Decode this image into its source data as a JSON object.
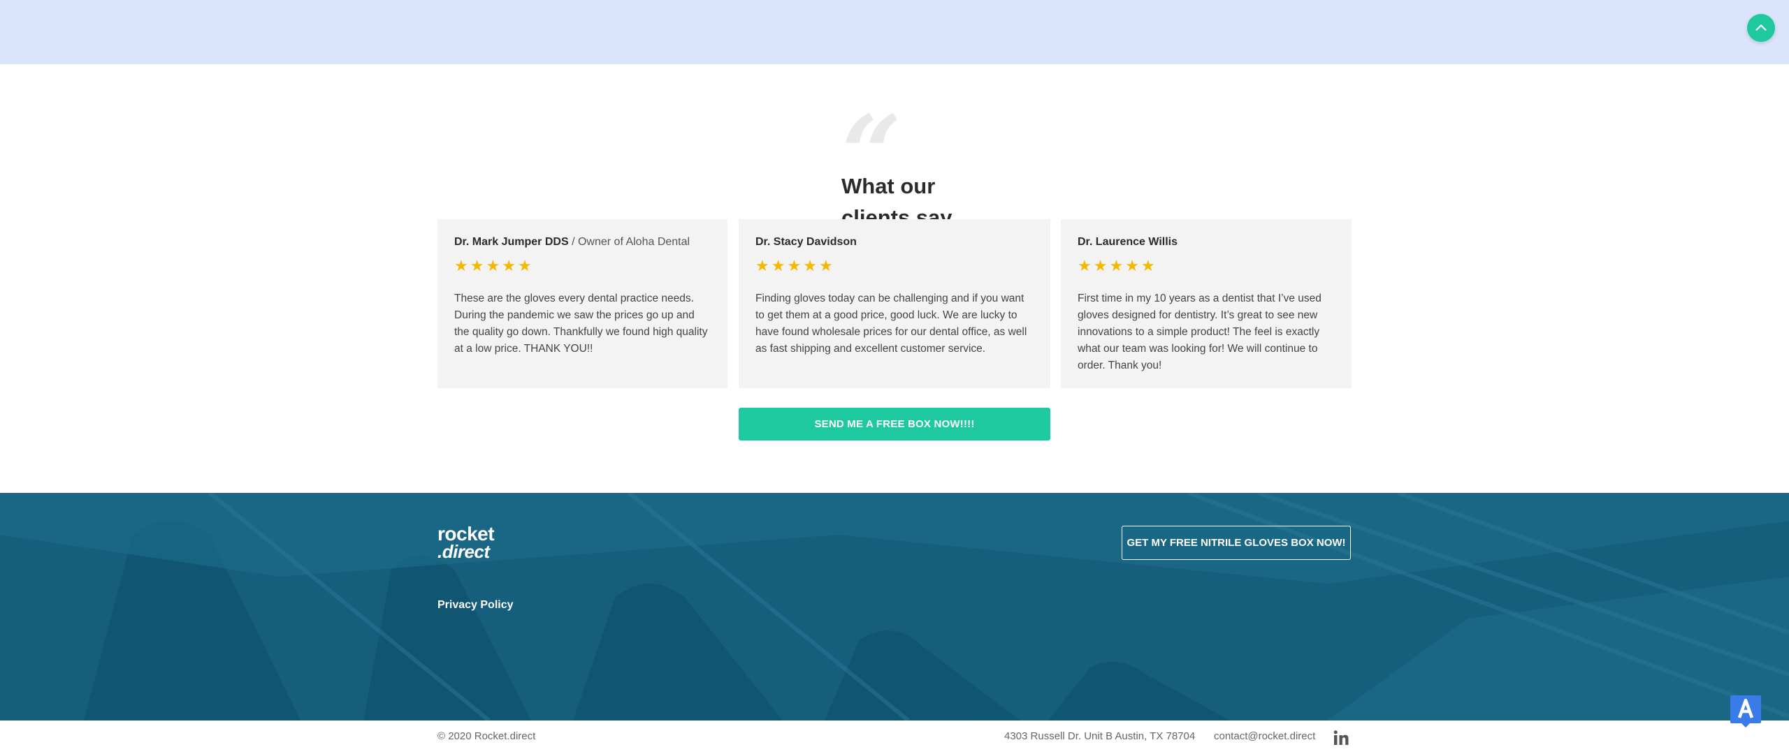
{
  "scroll_top": {
    "icon": "chevron-up-icon",
    "color": "#1ec99f"
  },
  "testimonials": {
    "heading": "What our\nclients say",
    "quote_glyph": "“",
    "cards": [
      {
        "name": "Dr. Mark Jumper DDS",
        "separator": "/",
        "role": "Owner of Aloha Dental",
        "rating": 5,
        "text": "These are the gloves every dental practice needs. During the pandemic we saw the prices go up and the quality go down. Thankfully we found high quality at a low price. THANK YOU!!"
      },
      {
        "name": "Dr. Stacy Davidson",
        "separator": "",
        "role": "",
        "rating": 5,
        "text": "Finding gloves today can be challenging and if you want to get them at a good price, good luck. We are lucky to have found wholesale prices for our dental office, as well as fast shipping and excellent customer service."
      },
      {
        "name": "Dr. Laurence Willis",
        "separator": "",
        "role": "",
        "rating": 5,
        "text": "First time in my 10 years as a dentist that I’ve used gloves designed for dentistry. It’s great to see new innovations to a simple product! The feel is exactly what our team was looking for! We will continue to order. Thank you!"
      }
    ],
    "cta_label": "SEND ME A FREE BOX NOW!!!!"
  },
  "footer": {
    "logo_line1": "rocket",
    "logo_line2": ".direct",
    "privacy_label": "Privacy Policy",
    "cta_label": "GET MY FREE NITRILE GLOVES BOX NOW!",
    "background_color": "#155f7c"
  },
  "bottom_bar": {
    "copyright": "© 2020 Rocket.direct",
    "address": "4303 Russell Dr. Unit B Austin, TX 78704",
    "email": "contact@rocket.direct",
    "social_icon": "linkedin-icon"
  },
  "badge": {
    "letter": "A",
    "color": "#3a7bea"
  },
  "colors": {
    "accent": "#1ec99f",
    "star": "#f5b800",
    "top_band": "#d9e5fb"
  }
}
